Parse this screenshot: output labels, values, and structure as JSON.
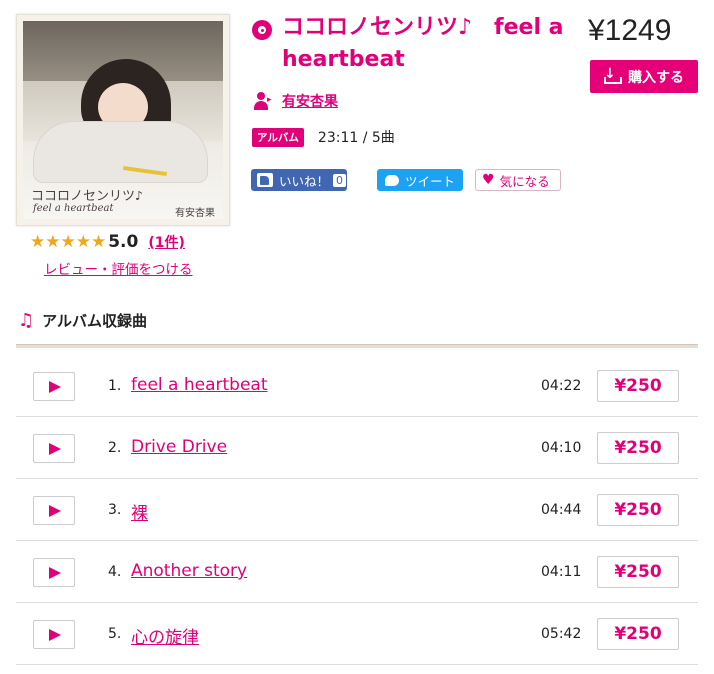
{
  "album": {
    "cover_title": "ココロノセンリツ♪",
    "cover_subtitle": "feel a heartbeat",
    "cover_artist": "有安杏果",
    "title": "ココロノセンリツ♪　feel a heartbeat",
    "price": "¥1249",
    "buy_label": "購入する",
    "artist": "有安杏果",
    "badge": "アルバム",
    "meta": "23:11 / 5曲"
  },
  "rating": {
    "stars": "★★★★★",
    "value": "5.0",
    "count": "(1件)",
    "review_link": "レビュー・評価をつける"
  },
  "social": {
    "like_label": "いいね！",
    "like_count": "0",
    "tweet_label": "ツイート",
    "fav_label": "気になる"
  },
  "section": {
    "icon": "music-note-icon",
    "title": "アルバム収録曲"
  },
  "tracks": [
    {
      "no": "1.",
      "title": "feel a heartbeat",
      "time": "04:22",
      "price": "¥250"
    },
    {
      "no": "2.",
      "title": "Drive Drive",
      "time": "04:10",
      "price": "¥250"
    },
    {
      "no": "3.",
      "title": "裸",
      "time": "04:44",
      "price": "¥250"
    },
    {
      "no": "4.",
      "title": "Another story",
      "time": "04:11",
      "price": "¥250"
    },
    {
      "no": "5.",
      "title": "心の旋律",
      "time": "05:42",
      "price": "¥250"
    }
  ],
  "colors": {
    "accent": "#e0007a",
    "buy_button": "#e60078",
    "facebook": "#4267b2",
    "twitter": "#1da1f2",
    "star": "#f0a81b"
  }
}
